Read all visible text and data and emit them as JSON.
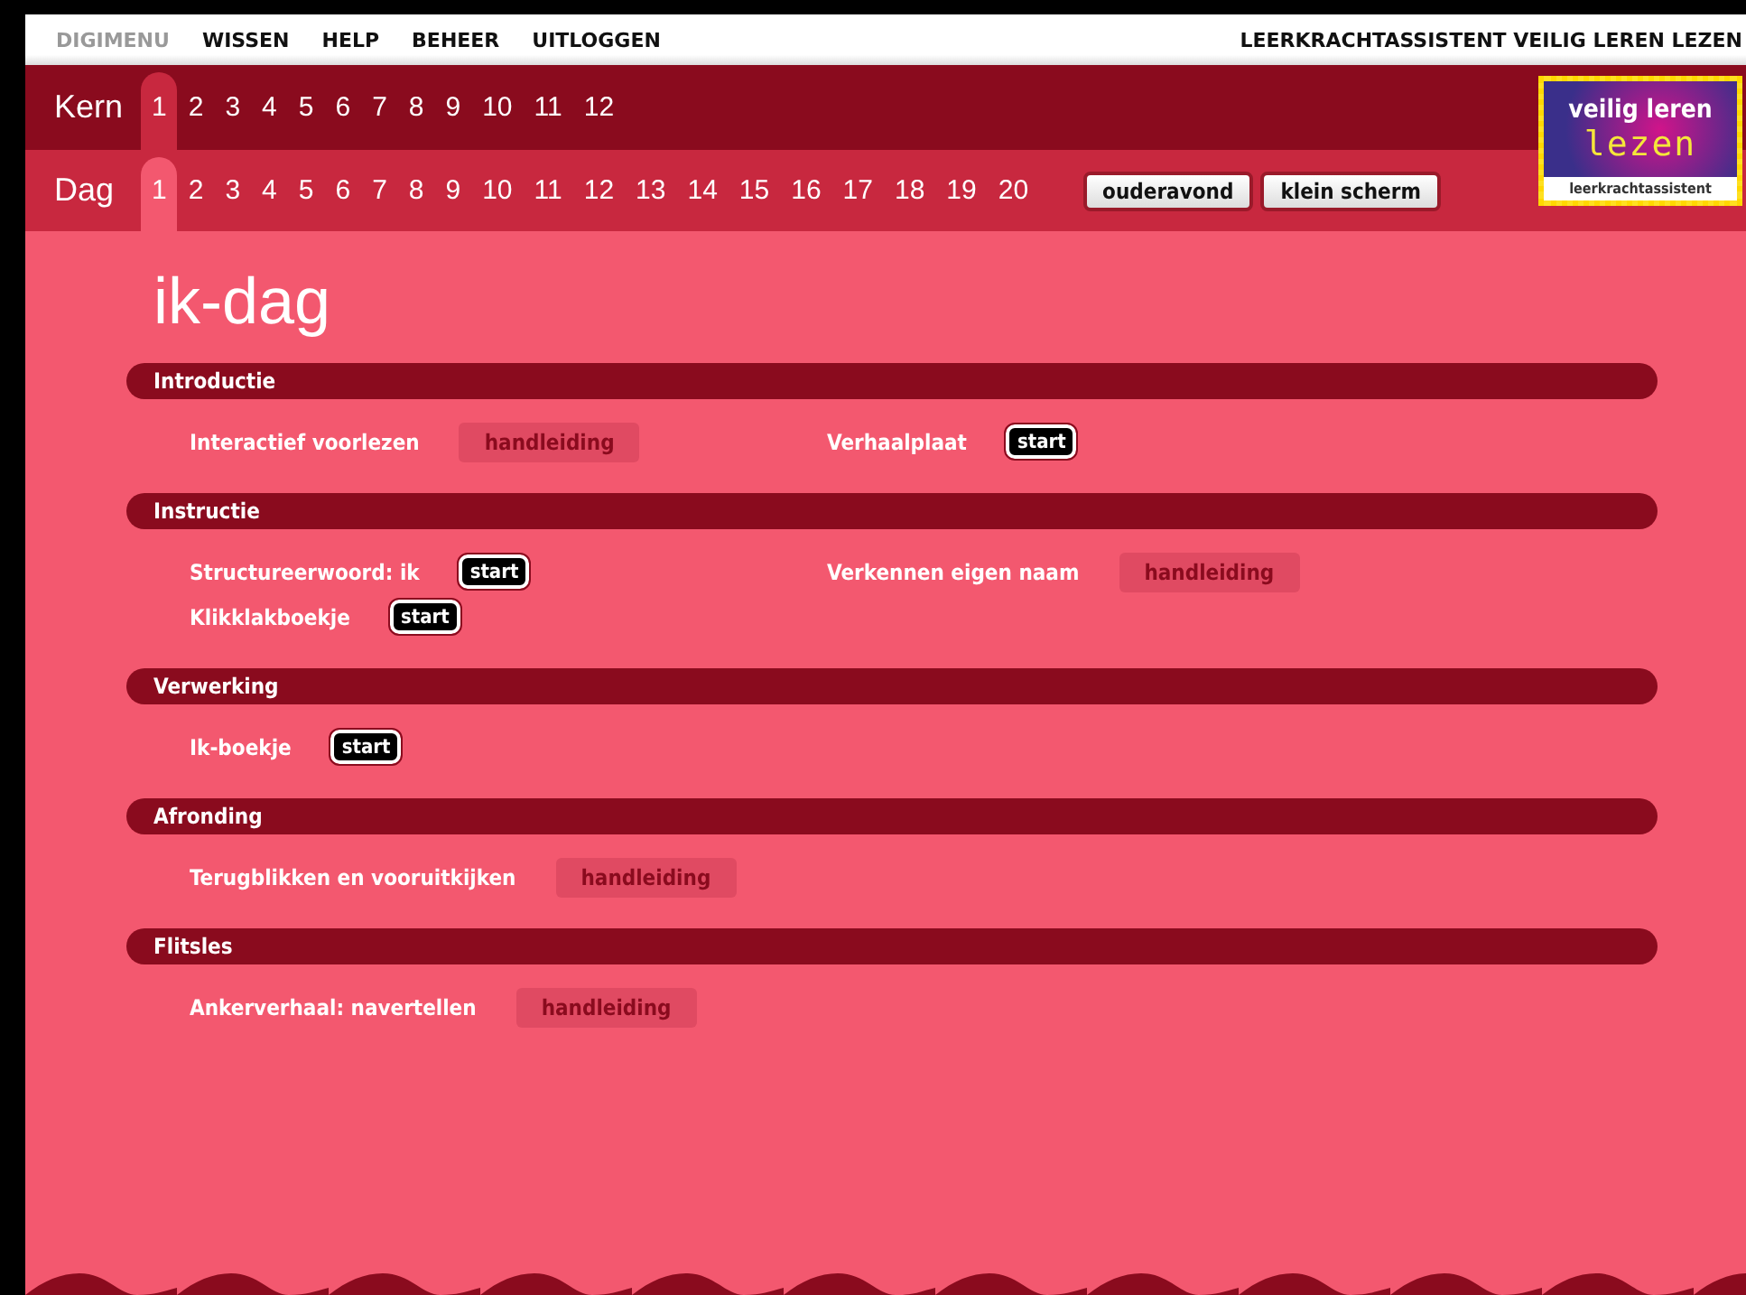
{
  "menu": {
    "items": [
      {
        "label": "DIGIMENU",
        "disabled": true
      },
      {
        "label": "WISSEN",
        "disabled": false
      },
      {
        "label": "HELP",
        "disabled": false
      },
      {
        "label": "BEHEER",
        "disabled": false
      },
      {
        "label": "UITLOGGEN",
        "disabled": false
      }
    ],
    "app_title": "LEERKRACHTASSISTENT VEILIG LEREN LEZEN"
  },
  "kern": {
    "label": "Kern",
    "tabs": [
      {
        "label": "1",
        "selected": true
      },
      {
        "label": "2",
        "selected": false
      },
      {
        "label": "3",
        "selected": false
      },
      {
        "label": "4",
        "selected": false
      },
      {
        "label": "5",
        "selected": false
      },
      {
        "label": "6",
        "selected": false
      },
      {
        "label": "7",
        "selected": false
      },
      {
        "label": "8",
        "selected": false
      },
      {
        "label": "9",
        "selected": false
      },
      {
        "label": "10",
        "selected": false
      },
      {
        "label": "11",
        "selected": false
      },
      {
        "label": "12",
        "selected": false
      }
    ]
  },
  "dag": {
    "label": "Dag",
    "tabs": [
      {
        "label": "1",
        "selected": true
      },
      {
        "label": "2",
        "selected": false
      },
      {
        "label": "3",
        "selected": false
      },
      {
        "label": "4",
        "selected": false
      },
      {
        "label": "5",
        "selected": false
      },
      {
        "label": "6",
        "selected": false
      },
      {
        "label": "7",
        "selected": false
      },
      {
        "label": "8",
        "selected": false
      },
      {
        "label": "9",
        "selected": false
      },
      {
        "label": "10",
        "selected": false
      },
      {
        "label": "11",
        "selected": false
      },
      {
        "label": "12",
        "selected": false
      },
      {
        "label": "13",
        "selected": false
      },
      {
        "label": "14",
        "selected": false
      },
      {
        "label": "15",
        "selected": false
      },
      {
        "label": "16",
        "selected": false
      },
      {
        "label": "17",
        "selected": false
      },
      {
        "label": "18",
        "selected": false
      },
      {
        "label": "19",
        "selected": false
      },
      {
        "label": "20",
        "selected": false
      }
    ],
    "buttons": [
      "ouderavond",
      "klein scherm"
    ]
  },
  "logo": {
    "line_1": "veilig leren",
    "line_2": "lezen",
    "line_3": "leerkrachtassistent"
  },
  "page_title": "ik-dag",
  "sections": [
    {
      "title": "Introductie",
      "rows": [
        [
          {
            "label": "Interactief voorlezen",
            "button": {
              "label": "handleiding",
              "kind": "manual"
            }
          },
          {
            "label": "Verhaalplaat",
            "button": {
              "label": "start",
              "kind": "start"
            }
          }
        ]
      ]
    },
    {
      "title": "Instructie",
      "rows": [
        [
          {
            "label": "Structureerwoord: ik",
            "button": {
              "label": "start",
              "kind": "start"
            }
          },
          {
            "label": "Verkennen eigen naam",
            "button": {
              "label": "handleiding",
              "kind": "manual"
            }
          }
        ],
        [
          {
            "label": "Klikklakboekje",
            "button": {
              "label": "start",
              "kind": "start"
            }
          }
        ]
      ]
    },
    {
      "title": "Verwerking",
      "rows": [
        [
          {
            "label": "Ik-boekje",
            "button": {
              "label": "start",
              "kind": "start"
            }
          }
        ]
      ]
    },
    {
      "title": "Afronding",
      "rows": [
        [
          {
            "label": "Terugblikken en vooruitkijken",
            "button": {
              "label": "handleiding",
              "kind": "manual"
            }
          }
        ]
      ]
    },
    {
      "title": "Flitsles",
      "rows": [
        [
          {
            "label": "Ankerverhaal: navertellen",
            "button": {
              "label": "handleiding",
              "kind": "manual"
            }
          }
        ]
      ]
    }
  ]
}
